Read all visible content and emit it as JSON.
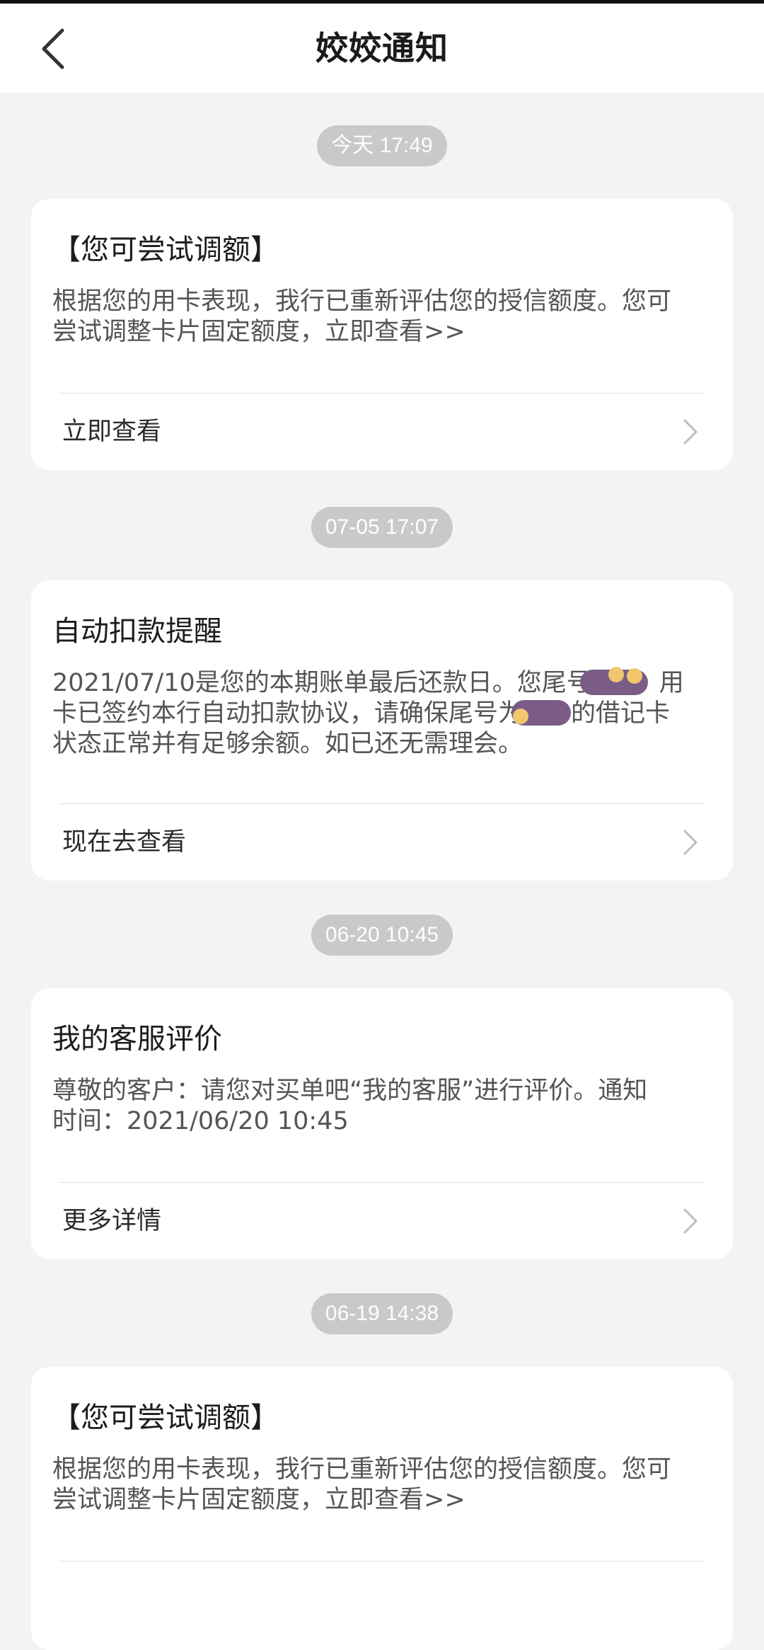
{
  "header": {
    "title": "姣姣通知",
    "back_icon": "back-arrow-icon"
  },
  "notifications": [
    {
      "time": "今天 17:49",
      "title": "【您可尝试调额】",
      "body_line1": "根据您的用卡表现，我行已重新评估您的授信额度。您可",
      "body_line2": "尝试调整卡片固定额度，立即查看>>",
      "action": "立即查看"
    },
    {
      "time": "07-05 17:07",
      "title": "自动扣款提醒",
      "body_line1_a": "2021/07/10是您的本期账单最后还款日。您尾号",
      "body_line1_b": "用",
      "body_line2_a": "卡已签约本行自动扣款协议，请确保尾号为",
      "body_line2_b": "的借记卡",
      "body_line3": "状态正常并有足够余额。如已还无需理会。",
      "action": "现在去查看"
    },
    {
      "time": "06-20 10:45",
      "title": "我的客服评价",
      "body_line1": "尊敬的客户：请您对买单吧“我的客服”进行评价。通知",
      "body_line2": "时间：2021/06/20 10:45",
      "action": "更多详情"
    },
    {
      "time": "06-19 14:38",
      "title": "【您可尝试调额】",
      "body_line1": "根据您的用卡表现，我行已重新评估您的授信额度。您可",
      "body_line2": "尝试调整卡片固定额度，立即查看>>"
    }
  ],
  "colors": {
    "page_bg": "#f3f3f3",
    "card_bg": "#ffffff",
    "time_pill": "#c9c9c9",
    "redaction": "#7a5c86"
  }
}
